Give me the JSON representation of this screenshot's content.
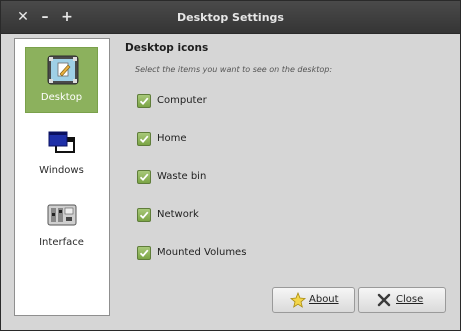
{
  "window": {
    "title": "Desktop Settings",
    "close_glyph": "✕",
    "minimize_glyph": "–",
    "maximize_glyph": "+"
  },
  "sidebar": {
    "items": [
      {
        "label": "Desktop",
        "icon": "desktop-icon",
        "active": true
      },
      {
        "label": "Windows",
        "icon": "windows-icon",
        "active": false
      },
      {
        "label": "Interface",
        "icon": "interface-icon",
        "active": false
      }
    ]
  },
  "desktop_icons": {
    "title": "Desktop icons",
    "description": "Select the items you want to see on the desktop:",
    "options": [
      {
        "label": "Computer",
        "checked": true
      },
      {
        "label": "Home",
        "checked": true
      },
      {
        "label": "Waste bin",
        "checked": true
      },
      {
        "label": "Network",
        "checked": true
      },
      {
        "label": "Mounted Volumes",
        "checked": true
      }
    ]
  },
  "buttons": {
    "about_label": "About",
    "close_label": "Close"
  },
  "colors": {
    "accent": "#8cb15d",
    "titlebar": "#3f3f3f",
    "background": "#d6d6d6"
  }
}
